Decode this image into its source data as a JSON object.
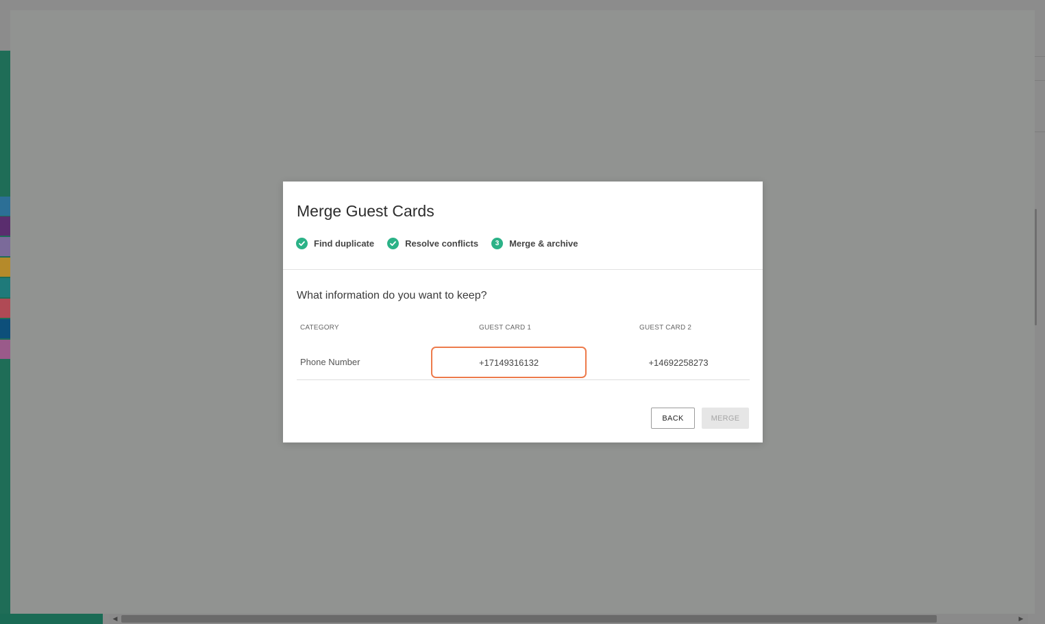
{
  "modal": {
    "title": "Merge Guest Cards",
    "steps": [
      {
        "label": "Find duplicate",
        "status": "complete",
        "icon": "check-circle-icon"
      },
      {
        "label": "Resolve conflicts",
        "status": "complete",
        "icon": "check-circle-icon"
      },
      {
        "label": "Merge & archive",
        "status": "current",
        "number": "3"
      }
    ],
    "question": "What information do you want to keep?",
    "table": {
      "headers": [
        "CATEGORY",
        "GUEST CARD 1",
        "GUEST CARD 2"
      ],
      "rows": [
        {
          "category": "Phone Number",
          "guest_card_1": "+17149316132",
          "guest_card_2": "+14692258273",
          "selected": "guest_card_1"
        }
      ]
    },
    "buttons": {
      "back": "BACK",
      "merge": "MERGE"
    }
  },
  "colors": {
    "accent_green": "#2bb287",
    "selection_outline": "#ed7a4a",
    "overlay": "#919391"
  }
}
